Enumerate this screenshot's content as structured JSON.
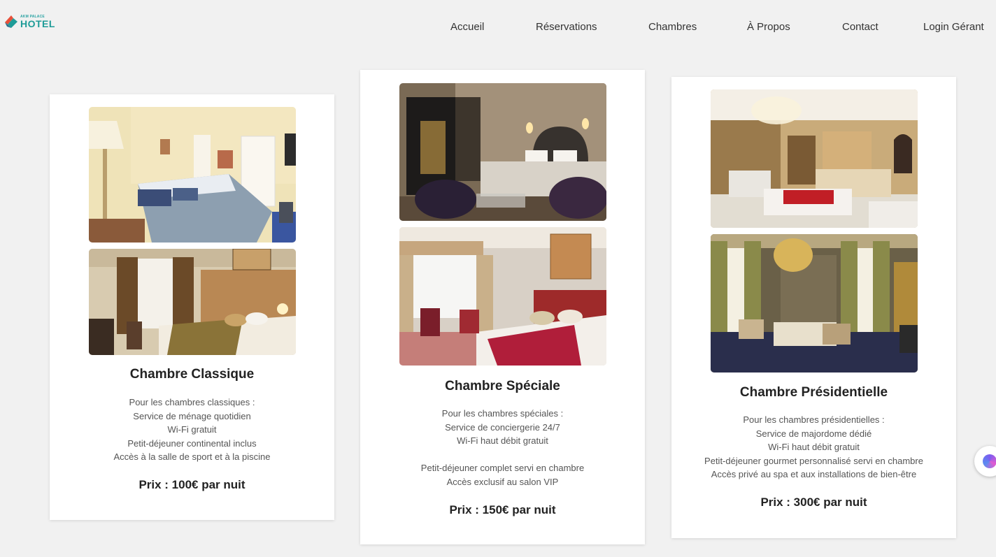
{
  "logo": {
    "small_text": "AKM PALACE",
    "big_text": "HOTEL"
  },
  "nav": [
    "Accueil",
    "Réservations",
    "Chambres",
    "À Propos",
    "Contact",
    "Login Gérant"
  ],
  "rooms": [
    {
      "title": "Chambre Classique",
      "lines": [
        "Pour les chambres classiques :",
        "Service de ménage quotidien",
        "Wi-Fi gratuit",
        "Petit-déjeuner continental inclus",
        "Accès à la salle de sport et à la piscine"
      ],
      "price": "Prix : 100€ par nuit"
    },
    {
      "title": "Chambre Spéciale",
      "lines": [
        "Pour les chambres spéciales :",
        "Service de conciergerie 24/7",
        "Wi-Fi haut débit gratuit",
        "",
        "Petit-déjeuner complet servi en chambre",
        "Accès exclusif au salon VIP"
      ],
      "price": "Prix : 150€ par nuit"
    },
    {
      "title": "Chambre Présidentielle",
      "lines": [
        "Pour les chambres présidentielles :",
        "Service de majordome dédié",
        "Wi-Fi haut débit gratuit",
        "Petit-déjeuner gourmet personnalisé servi en chambre",
        "Accès privé au spa et aux installations de bien-être"
      ],
      "price": "Prix : 300€ par nuit"
    }
  ]
}
